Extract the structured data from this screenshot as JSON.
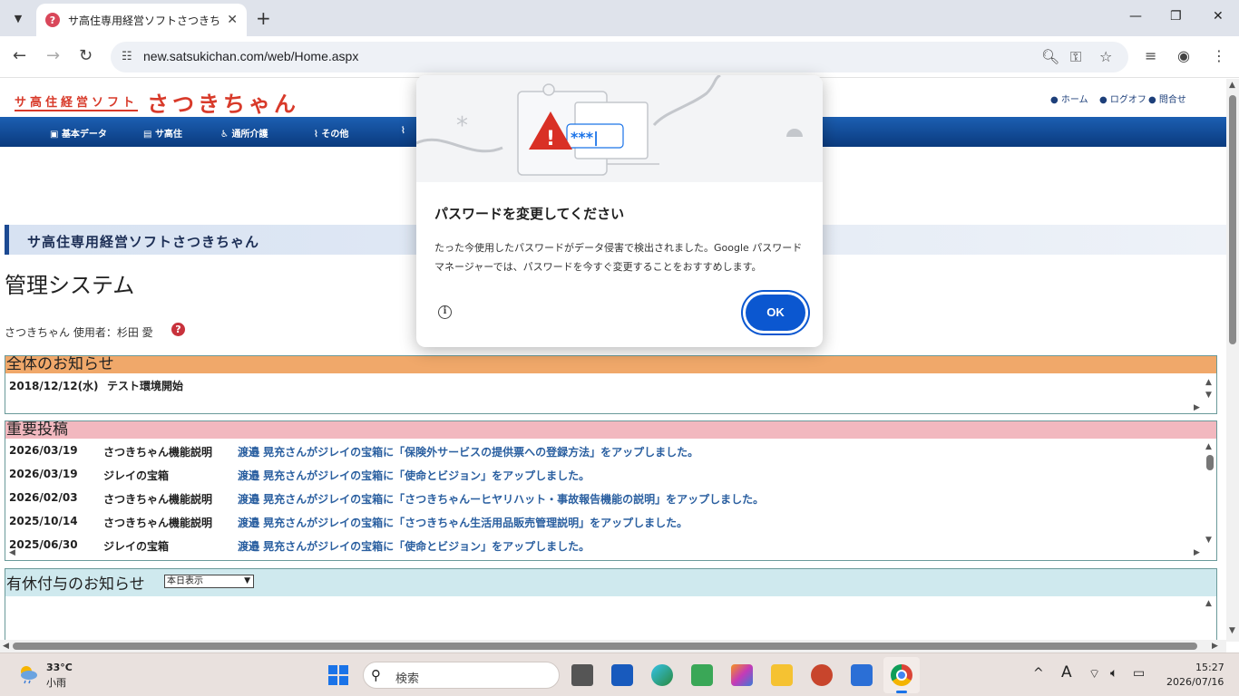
{
  "browser": {
    "tab_title": "サ高住専用経営ソフトさつきちゃん",
    "tab_favicon": "?",
    "url": "new.satsukichan.com/web/Home.aspx"
  },
  "site": {
    "logo_small": "サ高住経営ソフト",
    "logo_big": "さつきちゃん",
    "links": [
      "ホーム",
      "ログオフ",
      "問合せ"
    ],
    "nav": [
      "基本データ",
      "サ高住",
      "通所介護",
      "その他"
    ],
    "band_title": "サ高住専用経営ソフトさつきちゃん",
    "page_title": "管理システム",
    "user_line": "さつきちゃん 使用者：杉田 愛"
  },
  "notice": {
    "title": "全体のお知らせ",
    "rows": [
      {
        "date": "2018/12/12(水)",
        "text": "テスト環境開始"
      }
    ]
  },
  "important": {
    "title": "重要投稿",
    "rows": [
      {
        "date": "2026/03/19",
        "cat": "さつきちゃん機能説明",
        "msg": "渡邉 晃充さんがジレイの宝箱に「保険外サービスの提供票への登録方法」をアップしました。"
      },
      {
        "date": "2026/03/19",
        "cat": "ジレイの宝箱",
        "msg": "渡邉 晃充さんがジレイの宝箱に「使命とビジョン」をアップしました。"
      },
      {
        "date": "2026/02/03",
        "cat": "さつきちゃん機能説明",
        "msg": "渡邉 晃充さんがジレイの宝箱に「さつきちゃんーヒヤリハット・事故報告機能の説明」をアップしました。"
      },
      {
        "date": "2025/10/14",
        "cat": "さつきちゃん機能説明",
        "msg": "渡邉 晃充さんがジレイの宝箱に「さつきちゃん生活用品販売管理説明」をアップしました。"
      },
      {
        "date": "2025/06/30",
        "cat": "ジレイの宝箱",
        "msg": "渡邉 晃充さんがジレイの宝箱に「使命とビジョン」をアップしました。"
      }
    ]
  },
  "leave": {
    "title": "有休付与のお知らせ",
    "select_value": "本日表示"
  },
  "dialog": {
    "title": "パスワードを変更してください",
    "body": "たった今使用したパスワードがデータ侵害で検出されました。Google パスワード マネージャーでは、パスワードを今すぐ変更することをおすすめします。",
    "ok_label": "OK",
    "illustration_text": "***|"
  },
  "taskbar": {
    "temp": "33°C",
    "weather": "小雨",
    "search_placeholder": "検索",
    "ime": "A",
    "time": "15:27",
    "date": "2026/07/16"
  },
  "colors": {
    "chrome_blue": "#0b57d0",
    "nav_blue": "#0a3a7e",
    "notice_head": "#f0a86a",
    "important_head": "#f2b8bf",
    "leave_head": "#cfe9ee",
    "logo_red": "#d83a2a"
  }
}
